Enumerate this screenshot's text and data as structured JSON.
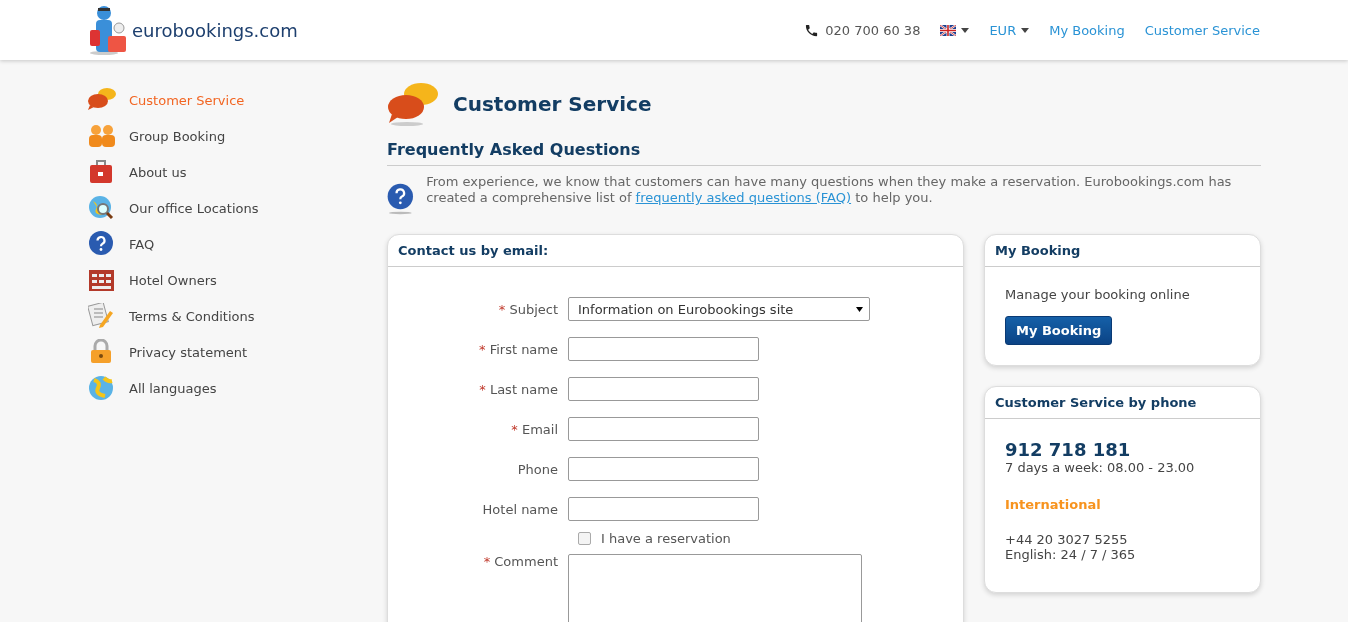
{
  "header": {
    "logo_text": "eurobookings.com",
    "phone": "020 700 60 38",
    "currency": "EUR",
    "links": [
      "My Booking",
      "Customer Service"
    ]
  },
  "sidebar": {
    "items": [
      {
        "label": "Customer Service",
        "selected": true
      },
      {
        "label": "Group Booking",
        "selected": false
      },
      {
        "label": "About us",
        "selected": false
      },
      {
        "label": "Our office Locations",
        "selected": false
      },
      {
        "label": "FAQ",
        "selected": false
      },
      {
        "label": "Hotel Owners",
        "selected": false
      },
      {
        "label": "Terms & Conditions",
        "selected": false
      },
      {
        "label": "Privacy statement",
        "selected": false
      },
      {
        "label": "All languages",
        "selected": false
      }
    ]
  },
  "main": {
    "title": "Customer Service",
    "section_title": "Frequently Asked Questions",
    "intro_before": "From experience, we know that customers can have many questions when they make a reservation. Eurobookings.com has created a comprehensive list of ",
    "intro_link": "frequently asked questions (FAQ)",
    "intro_after": " to help you."
  },
  "contact_form": {
    "title": "Contact us by email:",
    "required_mark": "*",
    "fields": [
      {
        "kind": "select",
        "label": "Subject",
        "required": true,
        "value": "Information on Eurobookings site"
      },
      {
        "kind": "text",
        "label": "First name",
        "required": true
      },
      {
        "kind": "text",
        "label": "Last name",
        "required": true
      },
      {
        "kind": "text",
        "label": "Email",
        "required": true
      },
      {
        "kind": "text",
        "label": "Phone",
        "required": false
      },
      {
        "kind": "text",
        "label": "Hotel name",
        "required": false
      },
      {
        "kind": "checkbox",
        "label": "I have a reservation",
        "checked": false
      },
      {
        "kind": "textarea",
        "label": "Comment",
        "required": true
      }
    ]
  },
  "my_booking": {
    "title": "My Booking",
    "text": "Manage your booking online",
    "button": "My Booking"
  },
  "phone_card": {
    "title": "Customer Service by phone",
    "number": "912 718 181",
    "hours": "7 days a week: 08.00 - 23.00",
    "intl_title": "International",
    "intl_number": "+44 20 3027 5255",
    "intl_hours": "English: 24 / 7 / 365"
  }
}
